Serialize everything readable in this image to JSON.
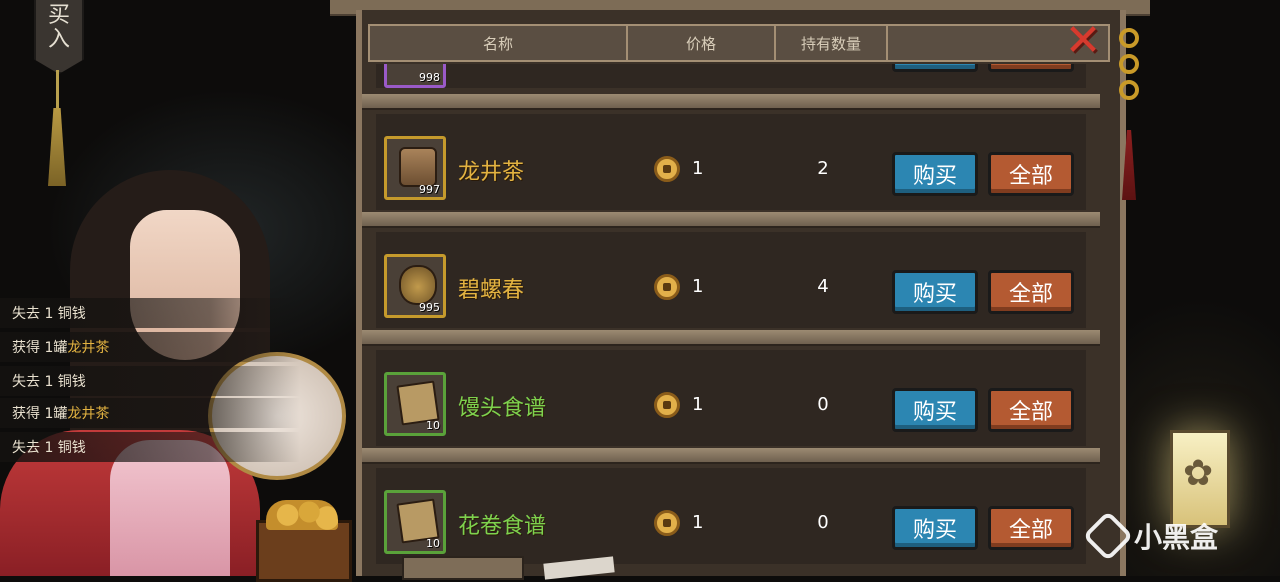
{
  "banner": {
    "text": "买\n入"
  },
  "header": {
    "col_name": "名称",
    "col_price": "价格",
    "col_owned": "持有数量"
  },
  "top_partial_item": {
    "count": "998"
  },
  "items": [
    {
      "name": "龙井茶",
      "count": "997",
      "price": "1",
      "owned": "2",
      "buy_label": "购买",
      "all_label": "全部",
      "icon": "tea-can-icon",
      "rarity": "gold"
    },
    {
      "name": "碧螺春",
      "count": "995",
      "price": "1",
      "owned": "4",
      "buy_label": "购买",
      "all_label": "全部",
      "icon": "tea-jar-icon",
      "rarity": "gold"
    },
    {
      "name": "馒头食谱",
      "count": "10",
      "price": "1",
      "owned": "0",
      "buy_label": "购买",
      "all_label": "全部",
      "icon": "recipe-icon",
      "rarity": "green"
    },
    {
      "name": "花卷食谱",
      "count": "10",
      "price": "1",
      "owned": "0",
      "buy_label": "购买",
      "all_label": "全部",
      "icon": "recipe-icon",
      "rarity": "green"
    }
  ],
  "log": [
    {
      "prefix": "失去 1 铜钱",
      "highlight": ""
    },
    {
      "prefix": "获得 1罐",
      "highlight": "龙井茶"
    },
    {
      "prefix": "失去 1 铜钱",
      "highlight": ""
    },
    {
      "prefix": "获得 1罐",
      "highlight": "龙井茶"
    },
    {
      "prefix": "失去 1 铜钱",
      "highlight": ""
    }
  ],
  "watermark": "小黑盒",
  "colors": {
    "name_gold": "#e3b341",
    "name_green": "#7ed24e",
    "buy_button": "#2c86b2",
    "all_button": "#b45a32",
    "close_red": "#d63a2e"
  }
}
